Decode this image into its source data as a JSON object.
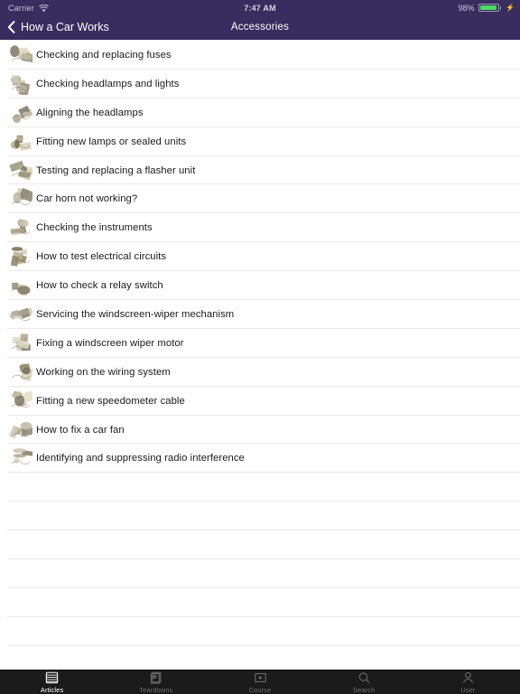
{
  "status_bar": {
    "carrier": "Carrier",
    "wifi_icon": "wifi-icon",
    "time": "7:47 AM",
    "battery_percent": "98%",
    "battery_level": 98,
    "battery_icon": "battery-icon",
    "charging_icon": "lightning-bolt-icon"
  },
  "nav_bar": {
    "back_icon": "chevron-left-icon",
    "back_label": "How a Car Works",
    "title": "Accessories",
    "background_color": "#382D5E",
    "text_color": "#FFFFFF"
  },
  "list": {
    "items": [
      {
        "label": "Checking and replacing fuses",
        "thumb": "fuses-thumbnail"
      },
      {
        "label": "Checking headlamps and lights",
        "thumb": "headlamps-thumbnail"
      },
      {
        "label": "Aligning the headlamps",
        "thumb": "headlamp-alignment-thumbnail"
      },
      {
        "label": "Fitting new lamps or sealed units",
        "thumb": "lamps-thumbnail"
      },
      {
        "label": "Testing and replacing a flasher unit",
        "thumb": "flasher-unit-thumbnail"
      },
      {
        "label": "Car horn not working?",
        "thumb": "car-horn-thumbnail"
      },
      {
        "label": "Checking the instruments",
        "thumb": "instruments-thumbnail"
      },
      {
        "label": "How to test electrical circuits",
        "thumb": "electrical-circuits-thumbnail"
      },
      {
        "label": "How to check a relay switch",
        "thumb": "relay-switch-thumbnail"
      },
      {
        "label": "Servicing the windscreen-wiper mechanism",
        "thumb": "wiper-mechanism-thumbnail"
      },
      {
        "label": "Fixing a windscreen wiper motor",
        "thumb": "wiper-motor-thumbnail"
      },
      {
        "label": "Working on the wiring system",
        "thumb": "wiring-system-thumbnail"
      },
      {
        "label": "Fitting a new speedometer cable",
        "thumb": "speedometer-cable-thumbnail"
      },
      {
        "label": "How to fix a car fan",
        "thumb": "car-fan-thumbnail"
      },
      {
        "label": "Identifying and suppressing radio interference",
        "thumb": "radio-interference-thumbnail"
      }
    ],
    "empty_row_count": 7,
    "separator_color": "#EBEBEB"
  },
  "tab_bar": {
    "background_color": "#1B1B1B",
    "active_color": "#FFFFFF",
    "inactive_color": "#6D6D6D",
    "tabs": [
      {
        "label": "Articles",
        "icon": "articles-icon",
        "active": true
      },
      {
        "label": "Teardowns",
        "icon": "teardowns-icon",
        "active": false
      },
      {
        "label": "Course",
        "icon": "course-icon",
        "active": false
      },
      {
        "label": "Search",
        "icon": "search-icon",
        "active": false
      },
      {
        "label": "User",
        "icon": "user-icon",
        "active": false
      }
    ]
  }
}
